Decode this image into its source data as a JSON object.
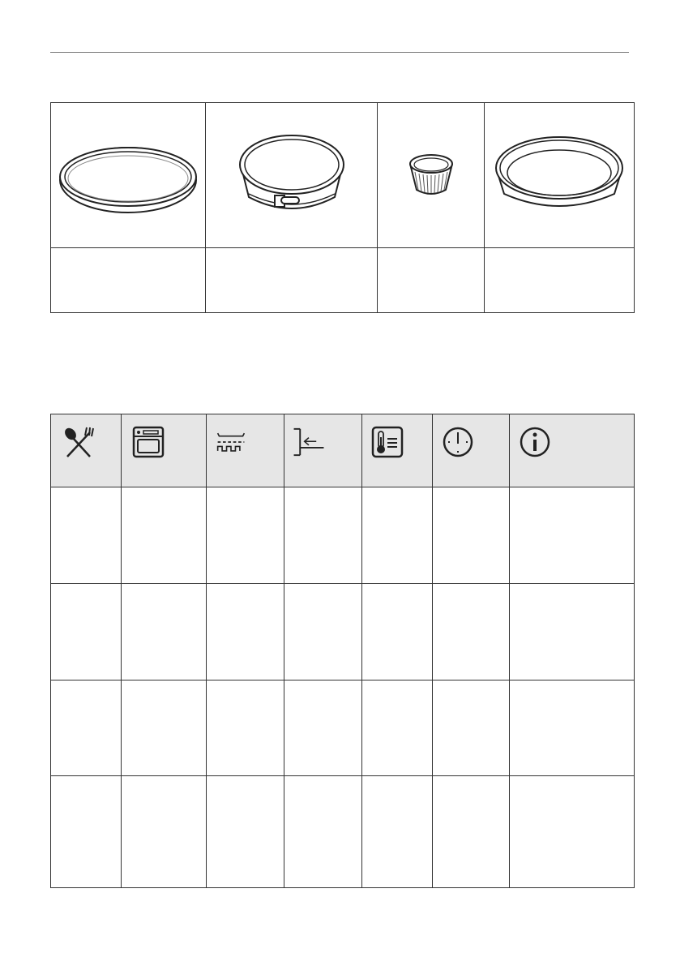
{
  "bakeware": {
    "items": [
      {
        "icon": "flat-tart-pan-icon",
        "text": ""
      },
      {
        "icon": "springform-pan-icon",
        "text": ""
      },
      {
        "icon": "ramekin-icon",
        "text": ""
      },
      {
        "icon": "deep-cake-pan-icon",
        "text": ""
      }
    ]
  },
  "settings_table": {
    "header_icons": [
      "food-type-icon",
      "oven-function-icon",
      "heating-element-icon",
      "shelf-position-icon",
      "temperature-icon",
      "time-icon",
      "info-icon"
    ],
    "rows": [
      [
        "",
        "",
        "",
        "",
        "",
        "",
        ""
      ],
      [
        "",
        "",
        "",
        "",
        "",
        "",
        ""
      ],
      [
        "",
        "",
        "",
        "",
        "",
        "",
        ""
      ],
      [
        "",
        "",
        "",
        "",
        "",
        "",
        ""
      ]
    ]
  }
}
